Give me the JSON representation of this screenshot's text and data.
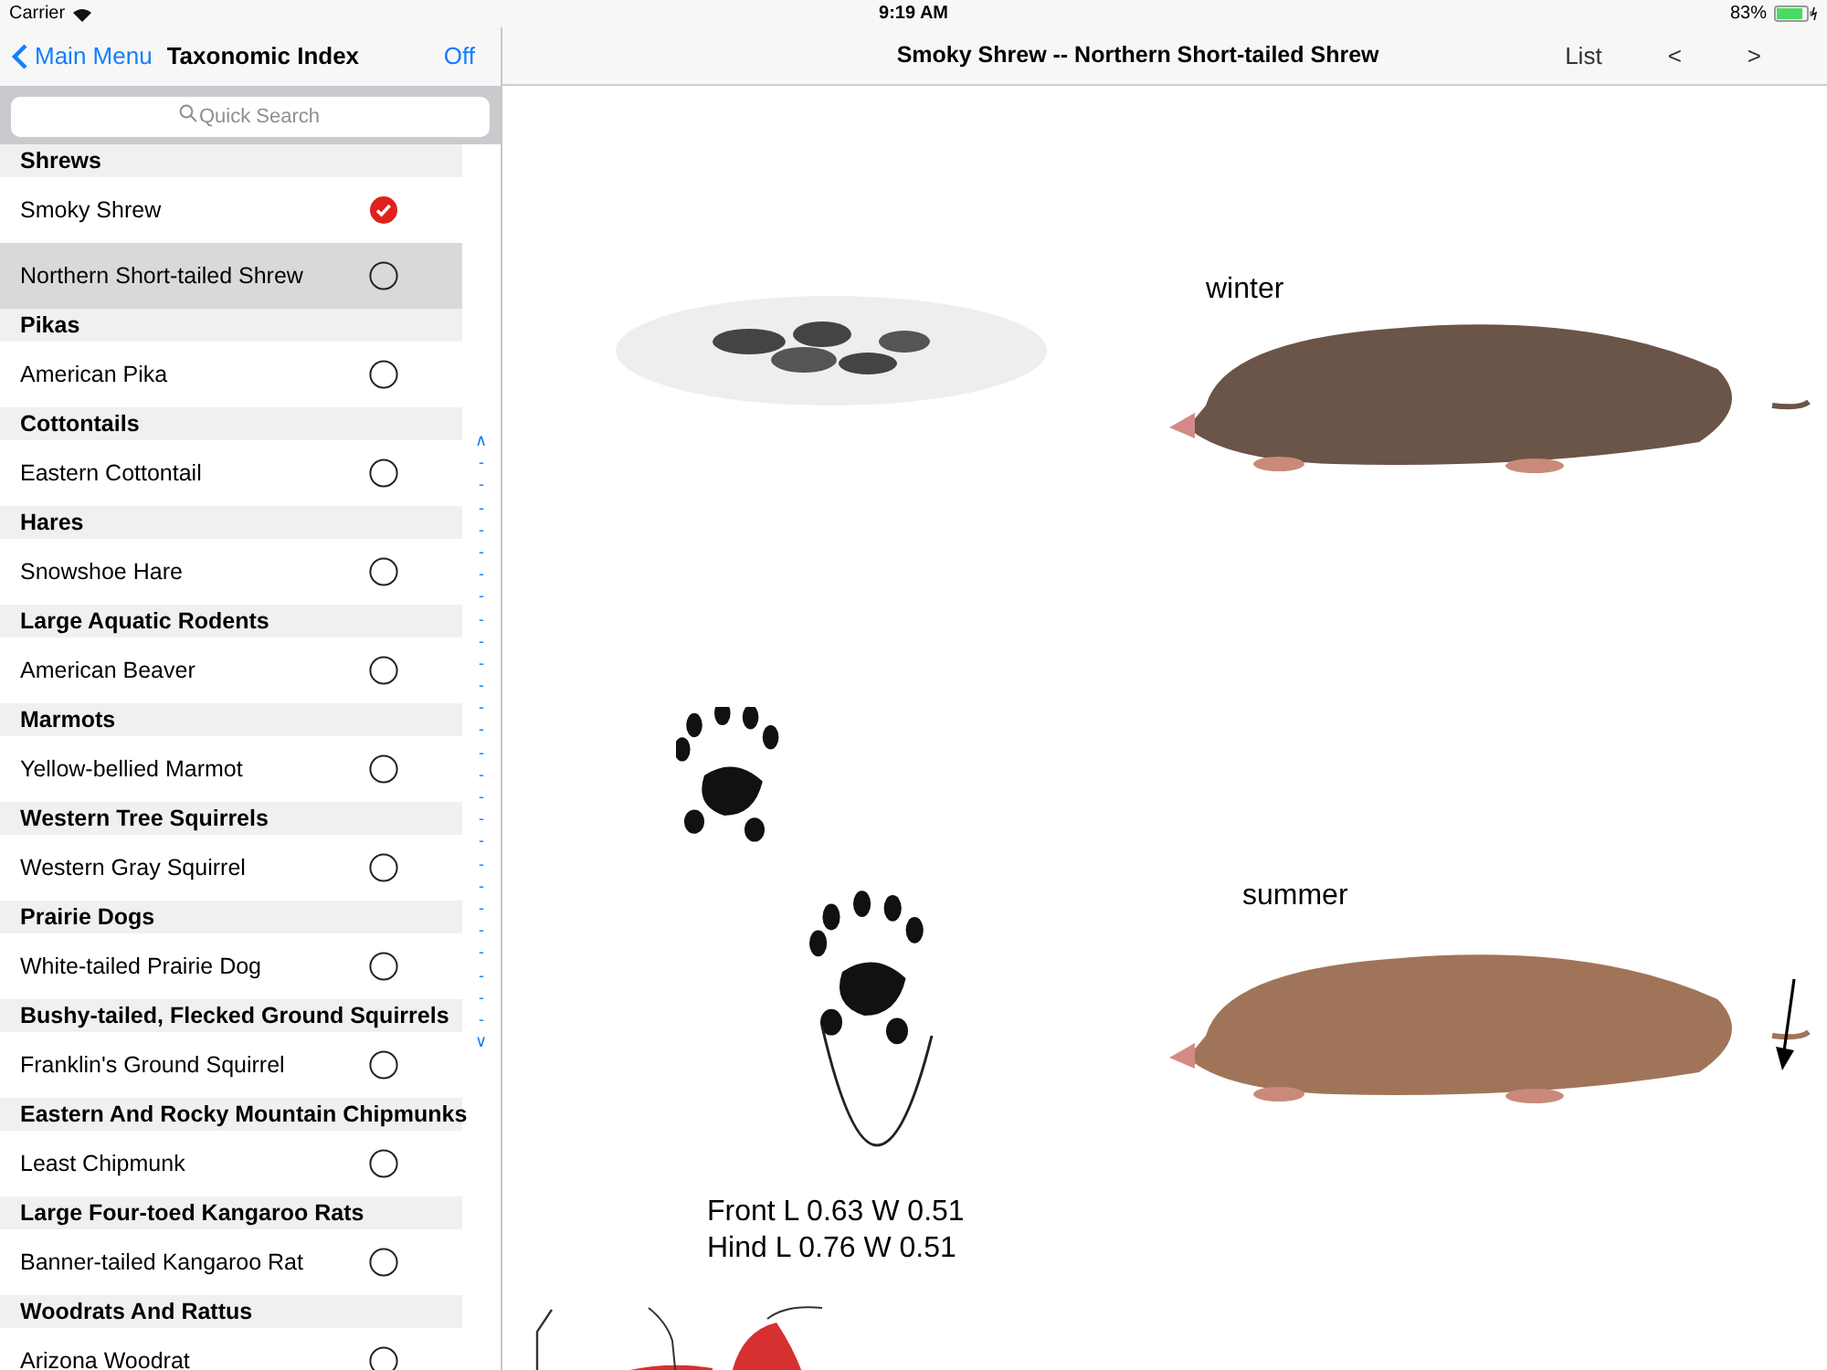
{
  "status_bar": {
    "carrier": "Carrier",
    "time": "9:19 AM",
    "battery": "83%"
  },
  "sidebar": {
    "back": "Main Menu",
    "title": "Taxonomic Index",
    "action": "Off",
    "search": {
      "placeholder": "Quick Search"
    },
    "sections": [
      {
        "title": "Shrews",
        "items": [
          {
            "name": "Smoky Shrew",
            "checked": true,
            "selected": false
          },
          {
            "name": "Northern Short-tailed Shrew",
            "checked": false,
            "selected": true
          }
        ]
      },
      {
        "title": "Pikas",
        "items": [
          {
            "name": "American Pika",
            "checked": false,
            "selected": false
          }
        ]
      },
      {
        "title": "Cottontails",
        "items": [
          {
            "name": "Eastern Cottontail",
            "checked": false,
            "selected": false
          }
        ]
      },
      {
        "title": "Hares",
        "items": [
          {
            "name": "Snowshoe Hare",
            "checked": false,
            "selected": false
          }
        ]
      },
      {
        "title": "Large Aquatic Rodents",
        "items": [
          {
            "name": "American Beaver",
            "checked": false,
            "selected": false
          }
        ]
      },
      {
        "title": "Marmots",
        "items": [
          {
            "name": "Yellow-bellied Marmot",
            "checked": false,
            "selected": false
          }
        ]
      },
      {
        "title": "Western Tree Squirrels",
        "items": [
          {
            "name": "Western Gray Squirrel",
            "checked": false,
            "selected": false
          }
        ]
      },
      {
        "title": "Prairie Dogs",
        "items": [
          {
            "name": "White-tailed Prairie Dog",
            "checked": false,
            "selected": false
          }
        ]
      },
      {
        "title": "Bushy-tailed, Flecked Ground Squirrels",
        "items": [
          {
            "name": "Franklin's Ground Squirrel",
            "checked": false,
            "selected": false
          }
        ]
      },
      {
        "title": "Eastern And Rocky Mountain Chipmunks",
        "items": [
          {
            "name": "Least Chipmunk",
            "checked": false,
            "selected": false
          }
        ]
      },
      {
        "title": "Large Four-toed Kangaroo Rats",
        "items": [
          {
            "name": "Banner-tailed Kangaroo Rat",
            "checked": false,
            "selected": false
          }
        ]
      },
      {
        "title": "Woodrats And Rattus",
        "items": [
          {
            "name": "Arizona Woodrat",
            "checked": false,
            "selected": false
          }
        ]
      }
    ],
    "index_strip": [
      "∧",
      "-",
      "-",
      "-",
      "-",
      "-",
      "-",
      "-",
      "-",
      "-",
      "-",
      "-",
      "-",
      "-",
      "-",
      "-",
      "-",
      "-",
      "-",
      "-",
      "-",
      "-",
      "-",
      "-",
      "-",
      "-",
      "-",
      "∨"
    ]
  },
  "detail": {
    "title": "Smoky Shrew -- Northern Short-tailed Shrew",
    "buttons": [
      "List",
      "<",
      ">"
    ],
    "plate": {
      "winter_label": "winter",
      "summer_label": "summer",
      "track_caption": [
        "Front L 0.63 W 0.51",
        "Hind L 0.76 W 0.51"
      ]
    }
  }
}
